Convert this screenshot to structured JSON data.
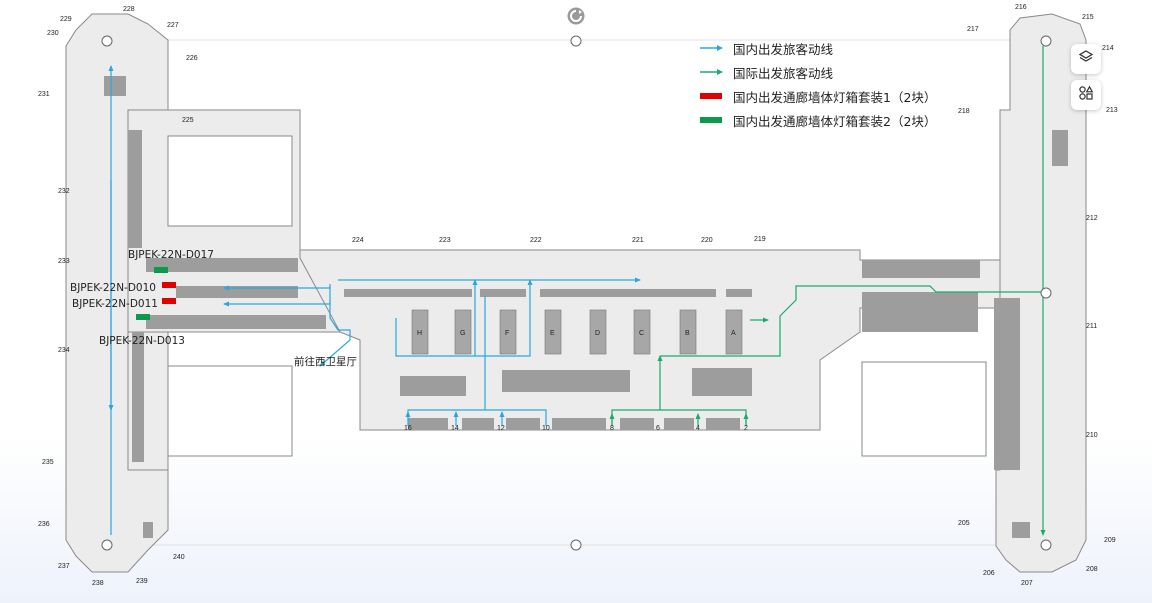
{
  "legend": {
    "items": [
      {
        "label": "国内出发旅客动线",
        "kind": "arrow",
        "color": "#29a8e0"
      },
      {
        "label": "国际出发旅客动线",
        "kind": "arrow",
        "color": "#1aab6b"
      },
      {
        "label": "国内出发通廊墙体灯箱套装1（2块）",
        "kind": "bar",
        "color": "#e00000"
      },
      {
        "label": "国内出发通廊墙体灯箱套装2（2块）",
        "kind": "bar",
        "color": "#0a9a4a"
      }
    ]
  },
  "ad_codes": {
    "d017": "BJPEK-22N-D017",
    "d010": "BJPEK-22N-D010",
    "d011": "BJPEK-22N-D011",
    "d013": "BJPEK-22N-D013"
  },
  "annotation": "前往西卫星厅",
  "gates_left": [
    "229",
    "228",
    "227",
    "230",
    "226",
    "231",
    "225",
    "232",
    "233",
    "234",
    "235",
    "236",
    "237",
    "238",
    "239",
    "240"
  ],
  "gates_top": [
    "224",
    "223",
    "222",
    "221",
    "220",
    "219"
  ],
  "gates_right": [
    "216",
    "215",
    "217",
    "214",
    "218",
    "213",
    "212",
    "211",
    "210",
    "205",
    "209",
    "206",
    "207",
    "208"
  ],
  "islands": [
    "H",
    "G",
    "F",
    "E",
    "D",
    "C",
    "B",
    "A"
  ],
  "doors": [
    "16",
    "14",
    "12",
    "10",
    "8",
    "6",
    "4",
    "2"
  ],
  "toolbar": {
    "layers_icon": "layers-icon",
    "shapes_icon": "shapes-icon",
    "rotate_icon": "rotate-icon"
  },
  "colors": {
    "domestic": "#29a8e0",
    "international": "#1aab6b",
    "building": "#ececec",
    "dark": "#9d9d9d"
  }
}
